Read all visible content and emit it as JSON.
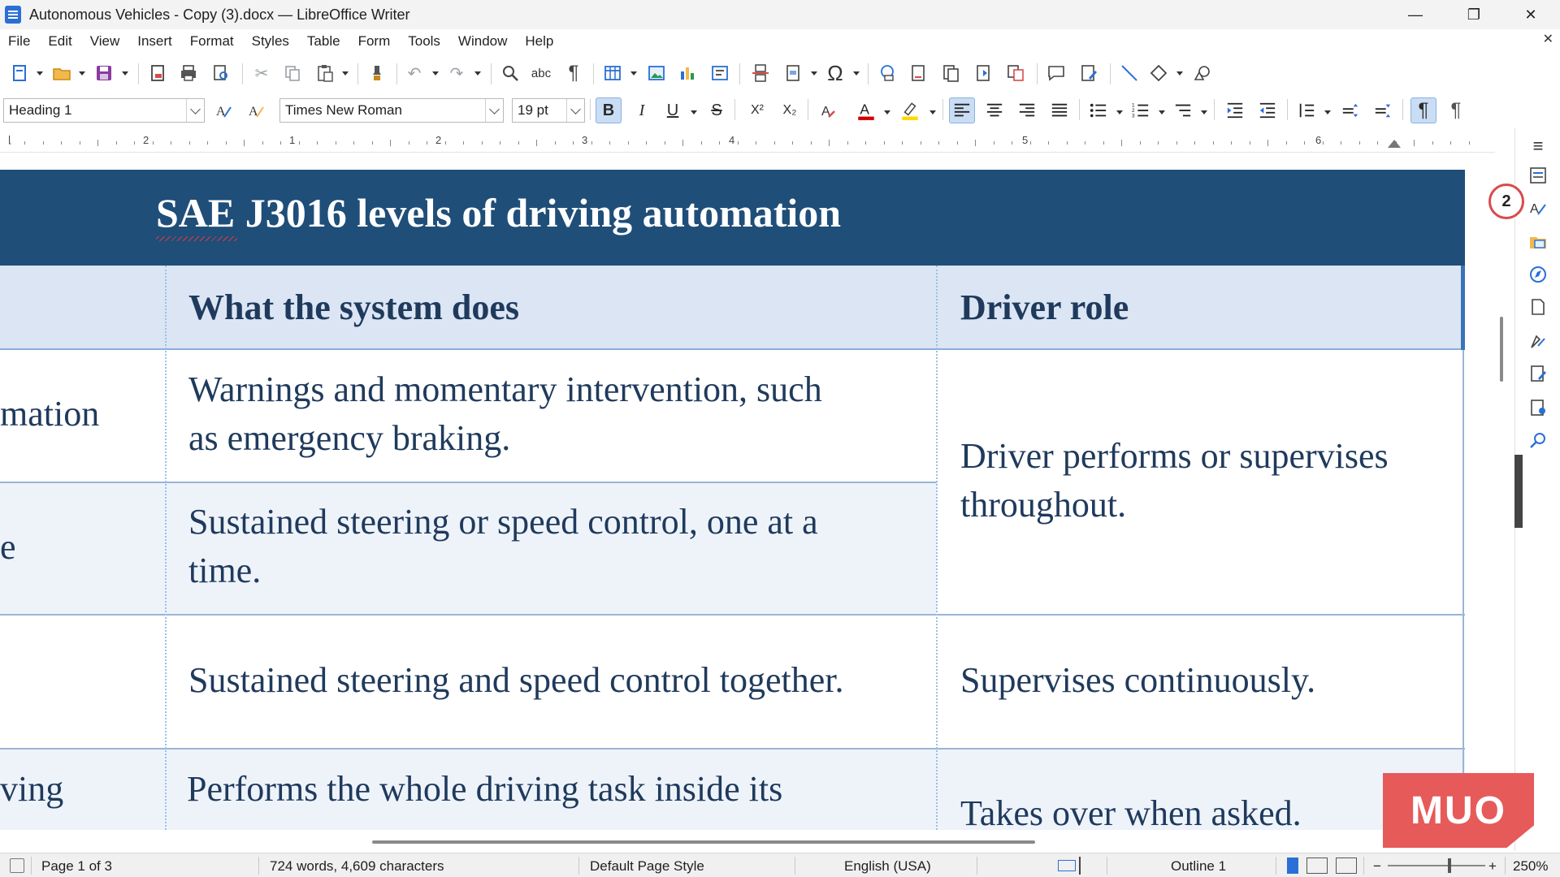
{
  "window": {
    "title": "Autonomous Vehicles - Copy (3).docx — LibreOffice Writer",
    "minimize": "—",
    "maximize": "❐",
    "close": "✕"
  },
  "menu": [
    "File",
    "Edit",
    "View",
    "Insert",
    "Format",
    "Styles",
    "Table",
    "Form",
    "Tools",
    "Window",
    "Help"
  ],
  "doc_close": "✕",
  "formatting": {
    "paragraph_style": "Heading 1",
    "font_name": "Times New Roman",
    "font_size": "19 pt",
    "bold": "B",
    "italic": "I",
    "underline": "U",
    "strike": "S",
    "superscript": "X²",
    "subscript": "X₂"
  },
  "ruler": [
    "2",
    "1",
    "1",
    "2",
    "3",
    "4",
    "5",
    "6"
  ],
  "document": {
    "table_title": "SAE J3016 levels of driving automation",
    "col_headers": [
      "What the system does",
      "Driver role"
    ],
    "rows": [
      {
        "col0": "mation",
        "col1_line1": "Warnings and momentary intervention, such",
        "col1_line2": "as emergency braking."
      },
      {
        "col0": "e",
        "col1_line1": "Sustained steering or speed control, one at a",
        "col1_line2": "time."
      },
      {
        "col0": "",
        "col1_line1": "Sustained steering and speed control together.",
        "col1_line2": ""
      },
      {
        "col0": "ving",
        "col1_line1": "Performs the whole driving task inside its",
        "col1_line2": ""
      }
    ],
    "driver_roles": {
      "merged_line1": "Driver performs or supervises",
      "merged_line2": "throughout.",
      "row3": "Supervises continuously.",
      "row4": "Takes over when asked."
    }
  },
  "badge": "2",
  "watermark": "MUO",
  "status": {
    "page": "Page 1 of 3",
    "words": "724 words, 4,609 characters",
    "page_style": "Default Page Style",
    "language": "English (USA)",
    "outline": "Outline 1",
    "zoom": "250%"
  }
}
